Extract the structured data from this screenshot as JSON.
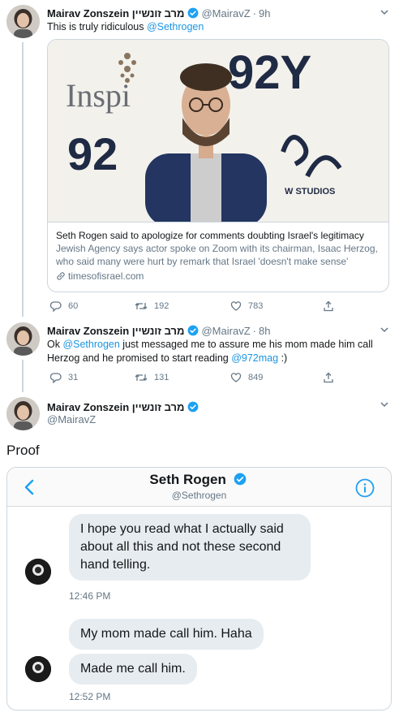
{
  "tweets": [
    {
      "name": "Mairav Zonszein מרב זונשיין",
      "handle": "@MairavZ",
      "dot": "·",
      "time": "9h",
      "text_pre": "This is truly ridiculous ",
      "mention": "@Sethrogen",
      "card": {
        "image_text": {
          "inspi": "Inspi",
          "y92_top": "92Y",
          "y92_mid": "92",
          "studios": "W STUDIOS"
        },
        "title": "Seth Rogen said to apologize for comments doubting Israel's legitimacy",
        "description": "Jewish Agency says actor spoke on Zoom with its chairman, Isaac Herzog, who said many were hurt by remark that Israel 'doesn't make sense'",
        "link": "timesofisrael.com"
      },
      "actions": {
        "replies": "60",
        "retweets": "192",
        "likes": "783"
      }
    },
    {
      "name": "Mairav Zonszein מרב זונשיין",
      "handle": "@MairavZ",
      "dot": "·",
      "time": "8h",
      "text_a": "Ok ",
      "mention_a": "@Sethrogen",
      "text_b": " just messaged me to assure me his mom made him call Herzog and he promised to start reading ",
      "mention_b": "@972mag",
      "text_c": " :)",
      "actions": {
        "replies": "31",
        "retweets": "131",
        "likes": "849"
      }
    },
    {
      "name": "Mairav Zonszein מרב זונשיין",
      "handle": "@MairavZ"
    }
  ],
  "proof_text": "Proof",
  "dm": {
    "title": "Seth Rogen",
    "subtitle": "@Sethrogen",
    "messages": [
      {
        "text": "I hope you read what I actually said about all this and not these second hand telling.",
        "time": "12:46 PM"
      },
      {
        "text": "My mom made call him. Haha"
      },
      {
        "text": "Made me call him.",
        "time": "12:52 PM"
      }
    ]
  },
  "colors": {
    "link_blue": "#1b95e0",
    "muted_gray": "#657786",
    "verified_blue": "#1da1f2",
    "border": "#ccd6dd"
  },
  "icons": [
    "verified-badge-icon",
    "chevron-down-icon",
    "reply-icon",
    "retweet-icon",
    "like-icon",
    "share-icon",
    "link-icon",
    "back-chevron-icon",
    "info-icon"
  ]
}
